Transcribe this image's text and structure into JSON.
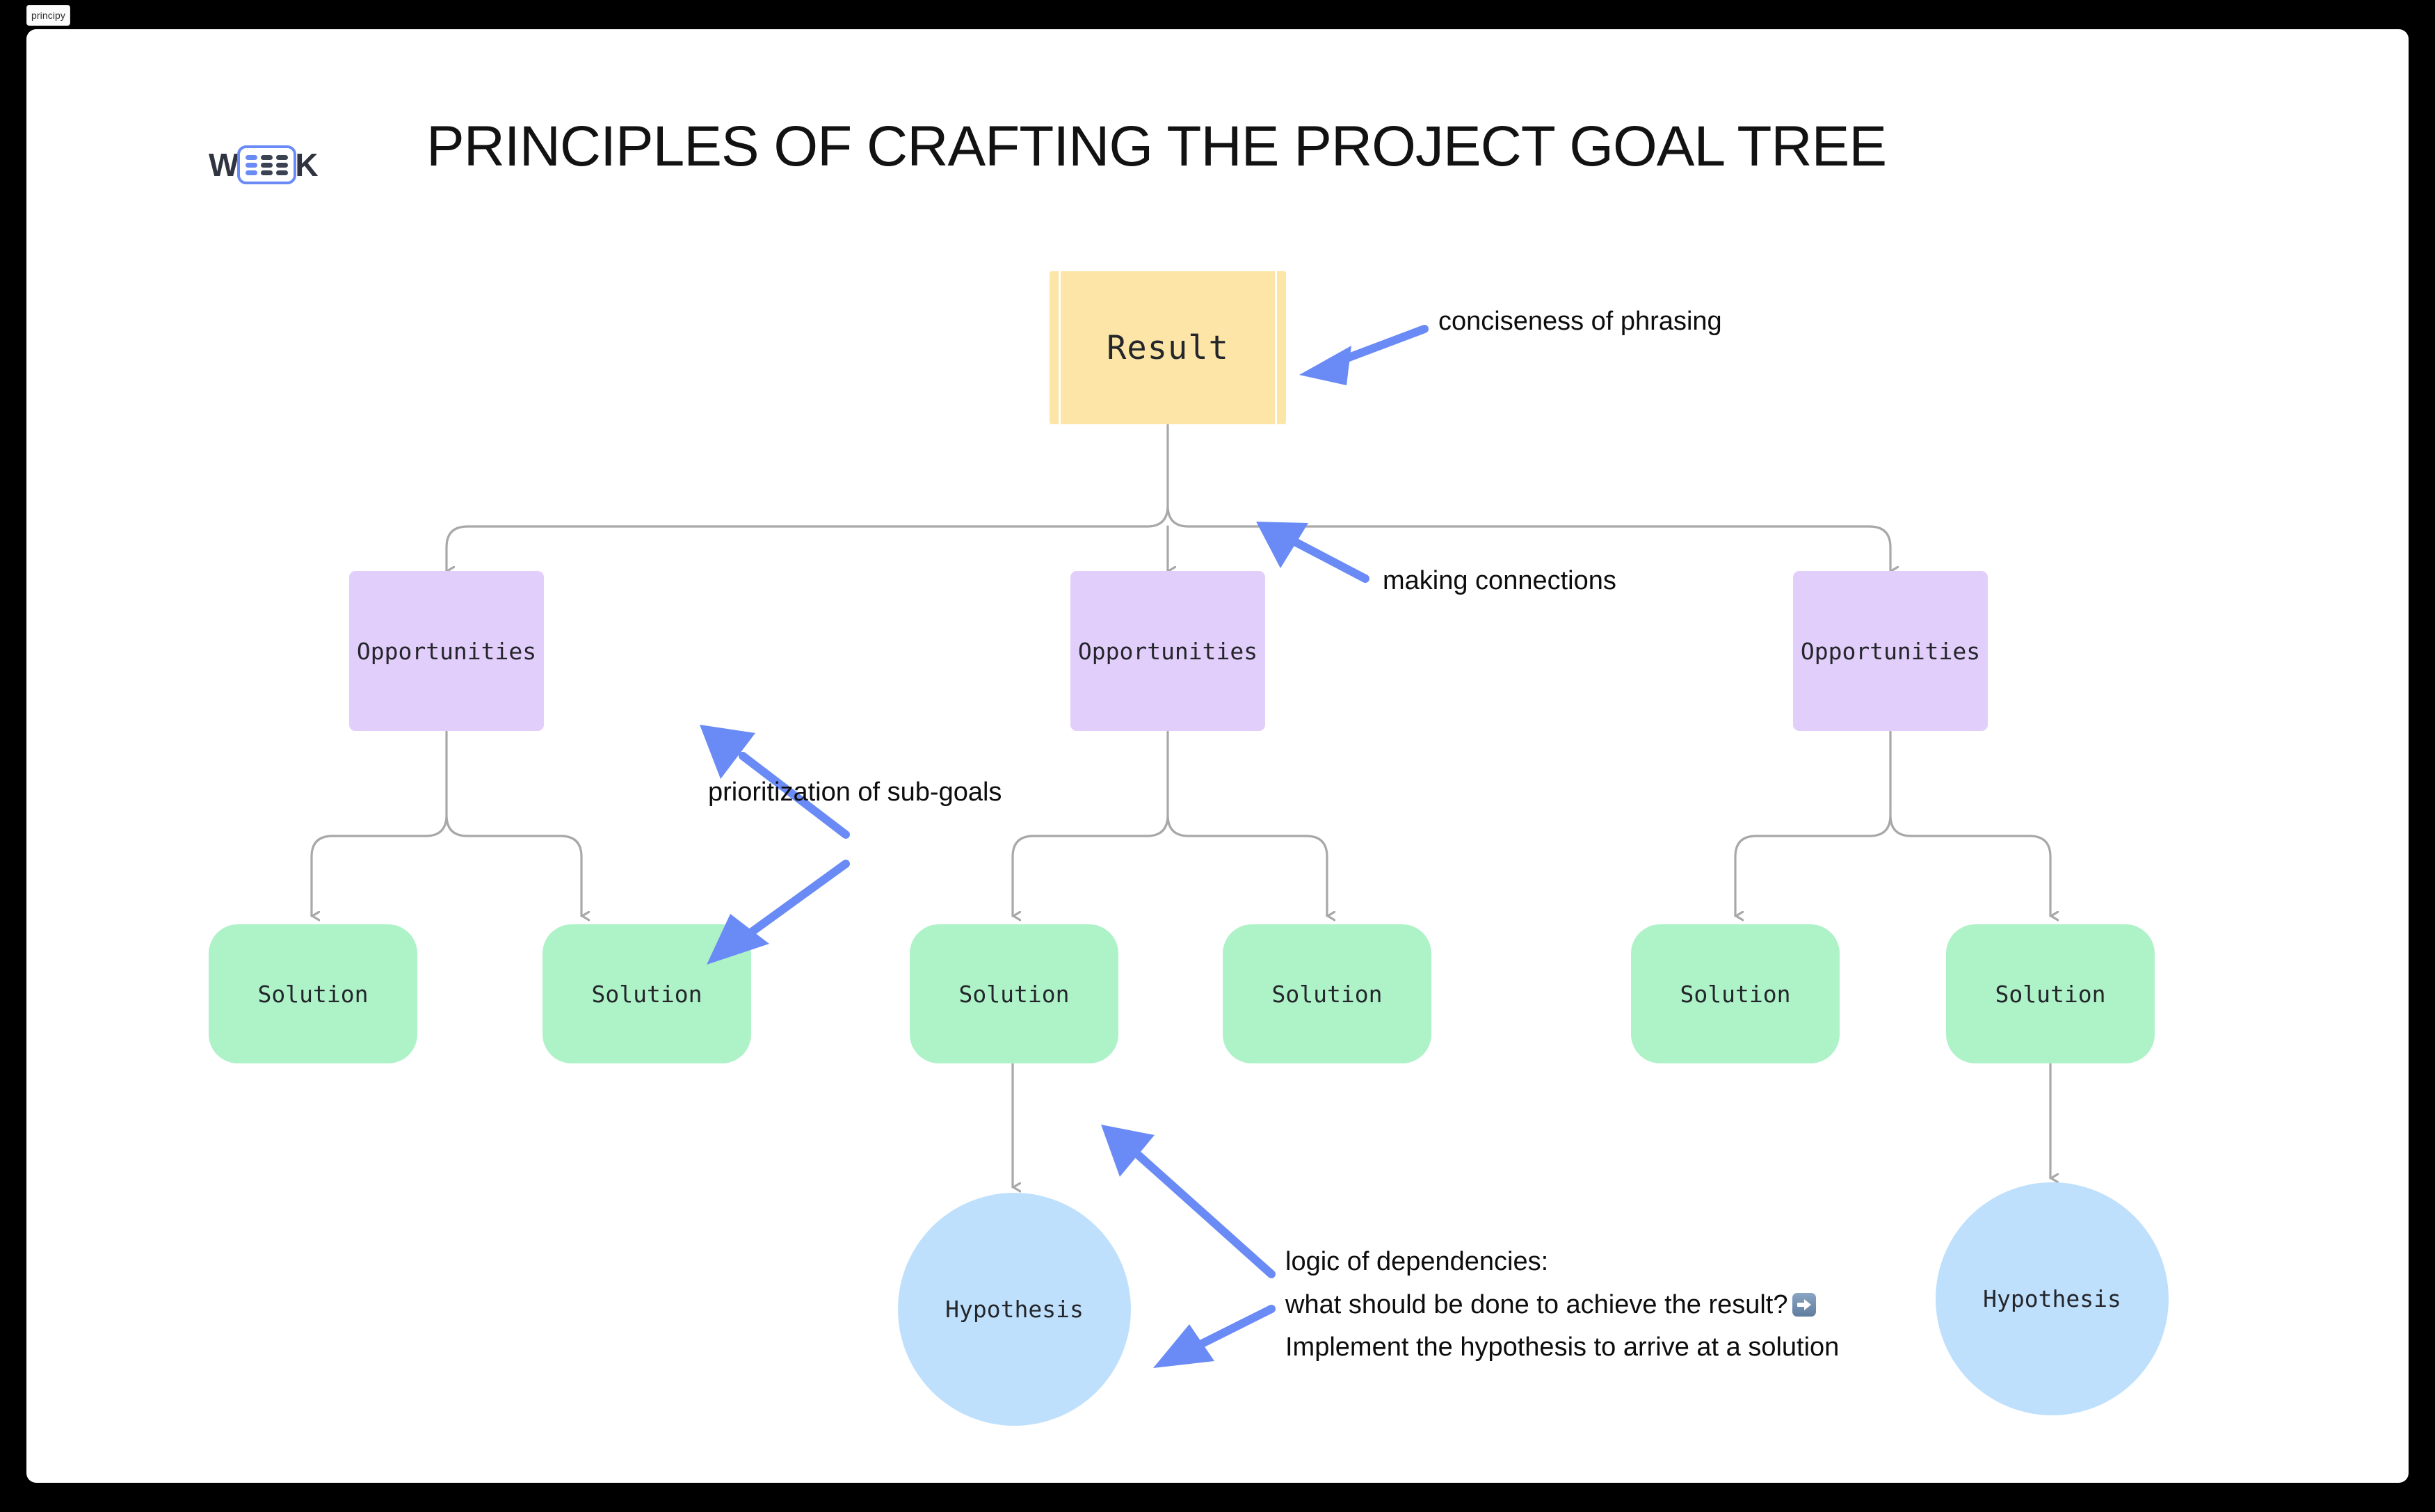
{
  "browser": {
    "tab_label": "principy"
  },
  "brand": {
    "logo_text_left": "W",
    "logo_text_right": "K"
  },
  "header": {
    "title": "PRINCIPLES OF CRAFTING THE PROJECT GOAL TREE"
  },
  "colors": {
    "result": "#fce5a6",
    "opportunity": "#e2cefb",
    "solution": "#aef2c8",
    "hypothesis": "#bfe0fc",
    "connector": "#a8a8a8",
    "annotation_arrow": "#6a8bf5",
    "canvas": "#ffffff",
    "page_background": "#000000"
  },
  "diagram": {
    "type": "goal-tree",
    "root": {
      "label": "Result"
    },
    "branches": [
      {
        "label": "Opportunities",
        "solutions": [
          {
            "label": "Solution",
            "hypothesis": null
          },
          {
            "label": "Solution",
            "hypothesis": null
          }
        ]
      },
      {
        "label": "Opportunities",
        "solutions": [
          {
            "label": "Solution",
            "hypothesis": {
              "label": "Hypothesis"
            }
          },
          {
            "label": "Solution",
            "hypothesis": null
          }
        ]
      },
      {
        "label": "Opportunities",
        "solutions": [
          {
            "label": "Solution",
            "hypothesis": null
          },
          {
            "label": "Solution",
            "hypothesis": {
              "label": "Hypothesis"
            }
          }
        ]
      }
    ]
  },
  "annotations": {
    "conciseness": "conciseness of phrasing",
    "connections": "making connections",
    "prioritization": "prioritization of sub-goals",
    "dependencies_line1": "logic of dependencies:",
    "dependencies_line2": "what should be done to achieve the result?",
    "dependencies_line3": "Implement the hypothesis to arrive at a solution"
  }
}
